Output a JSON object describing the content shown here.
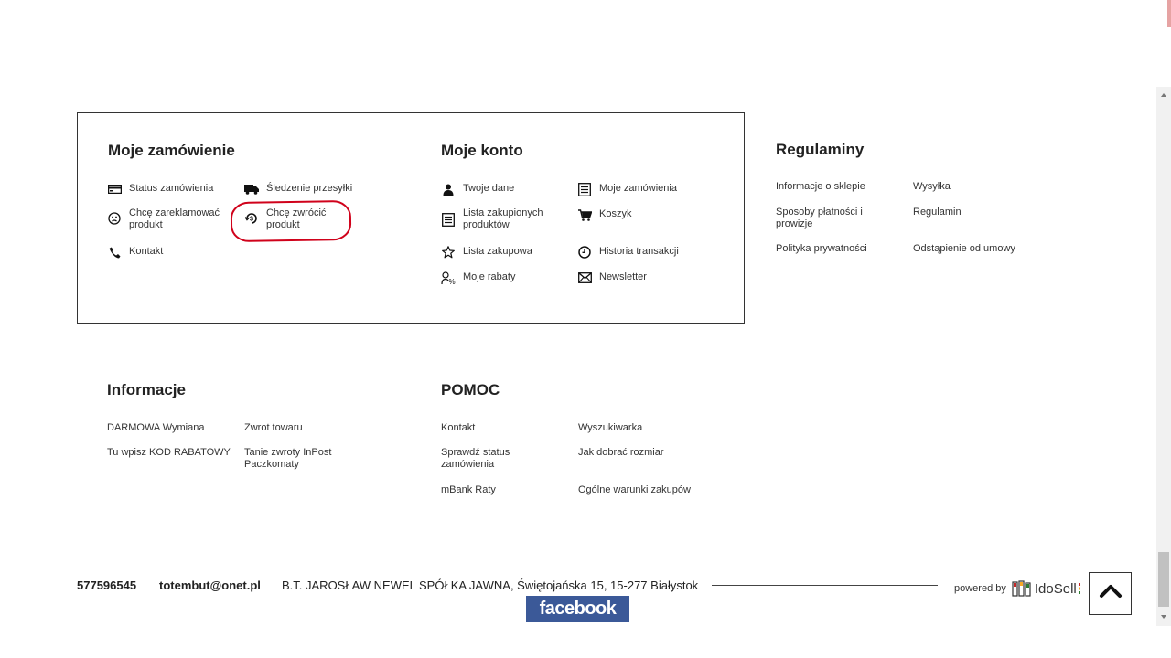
{
  "orders": {
    "title": "Moje zamówienie",
    "items": [
      {
        "label": "Status zamówienia",
        "icon": "card-icon"
      },
      {
        "label": "Śledzenie przesyłki",
        "icon": "truck-icon"
      },
      {
        "label": "Chcę zareklamować produkt",
        "line1": "Chcę zareklamować",
        "line2": "produkt",
        "icon": "sad-face-icon"
      },
      {
        "label": "Chcę zwrócić produkt",
        "line1": "Chcę zwrócić",
        "line2": "produkt",
        "icon": "return-icon"
      },
      {
        "label": "Kontakt",
        "icon": "phone-icon"
      }
    ]
  },
  "account": {
    "title": "Moje konto",
    "items": [
      {
        "label": "Twoje dane",
        "icon": "user-icon"
      },
      {
        "label": "Moje zamówienia",
        "icon": "document-icon"
      },
      {
        "line1": "Lista zakupionych",
        "line2": "produktów",
        "icon": "list-icon"
      },
      {
        "label": "Koszyk",
        "icon": "cart-icon"
      },
      {
        "label": "Lista zakupowa",
        "icon": "star-icon"
      },
      {
        "label": "Historia transakcji",
        "icon": "clock-icon"
      },
      {
        "label": "Moje rabaty",
        "icon": "discount-icon"
      },
      {
        "label": "Newsletter",
        "icon": "envelope-icon"
      }
    ]
  },
  "regulations": {
    "title": "Regulaminy",
    "items": [
      {
        "label": "Informacje o sklepie"
      },
      {
        "label": "Wysyłka"
      },
      {
        "line1": "Sposoby płatności i",
        "line2": "prowizje"
      },
      {
        "label": "Regulamin"
      },
      {
        "label": "Polityka prywatności"
      },
      {
        "label": "Odstąpienie od umowy"
      }
    ]
  },
  "information": {
    "title": "Informacje",
    "items": [
      {
        "label": "DARMOWA Wymiana"
      },
      {
        "label": "Zwrot towaru"
      },
      {
        "label": "Tu wpisz KOD RABATOWY"
      },
      {
        "line1": "Tanie zwroty InPost",
        "line2": "Paczkomaty"
      }
    ]
  },
  "help": {
    "title": "POMOC",
    "items": [
      {
        "label": "Kontakt"
      },
      {
        "label": "Wyszukiwarka"
      },
      {
        "line1": "Sprawdź status",
        "line2": "zamówienia"
      },
      {
        "label": "Jak dobrać rozmiar"
      },
      {
        "label": "mBank Raty"
      },
      {
        "label": "Ogólne warunki zakupów"
      }
    ]
  },
  "footer": {
    "phone": "577596545",
    "email": "totembut@onet.pl",
    "company": "B.T. JAROSŁAW NEWEL SPÓŁKA JAWNA, Świętojańska 15, 15-277 Białystok",
    "facebook": "facebook",
    "powered_by": "powered by",
    "brand": "IdoSell"
  },
  "colors": {
    "facebook": "#3b5998",
    "highlight": "#d0021b"
  }
}
